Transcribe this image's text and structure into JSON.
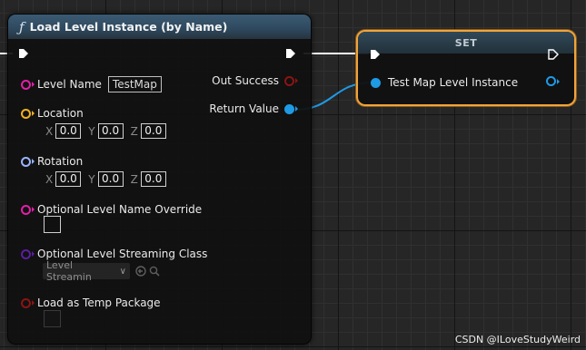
{
  "colors": {
    "exec": "#ffffff",
    "string_pin": "#e020a8",
    "bool_pin": "#8c1414",
    "struct_location": "#f0b020",
    "struct_rotation": "#9ab4ff",
    "class_pin": "#5a1ea0",
    "object_pin": "#1f9ae4",
    "selection_outline": "#f2a43a"
  },
  "load_node": {
    "title": "Load Level Instance (by Name)",
    "title_icon": "function-icon",
    "outputs": {
      "out_success": "Out Success",
      "return_value": "Return Value"
    },
    "level_name": {
      "label": "Level Name",
      "value": "TestMap"
    },
    "location": {
      "label": "Location",
      "x_axis": "X",
      "y_axis": "Y",
      "z_axis": "Z",
      "x": "0.0",
      "y": "0.0",
      "z": "0.0"
    },
    "rotation": {
      "label": "Rotation",
      "x_axis": "X",
      "y_axis": "Y",
      "z_axis": "Z",
      "x": "0.0",
      "y": "0.0",
      "z": "0.0"
    },
    "level_name_override": {
      "label": "Optional Level Name Override"
    },
    "streaming_class": {
      "label": "Optional Level Streaming Class",
      "dropdown": "Level Streamin"
    },
    "temp_package": {
      "label": "Load as Temp Package"
    }
  },
  "set_node": {
    "title": "SET",
    "variable": "Test Map Level Instance"
  },
  "watermark": "CSDN @ILoveStudyWeird"
}
